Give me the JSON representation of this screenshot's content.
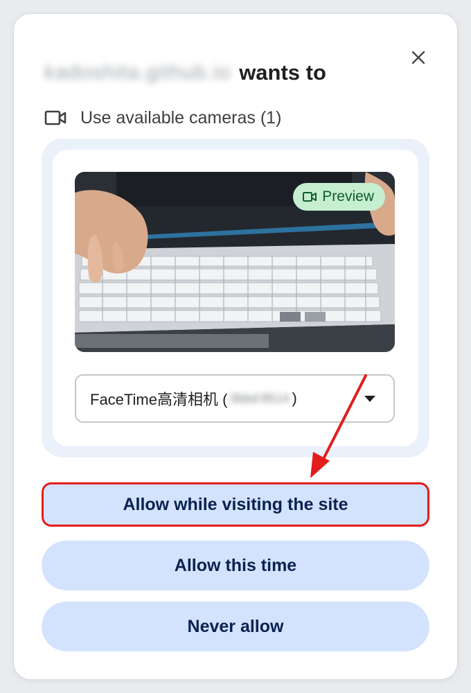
{
  "dialog": {
    "origin_text": "kadoshita.github.io",
    "title_suffix": "wants to",
    "close_icon": "close-icon"
  },
  "permission": {
    "icon": "video-camera-icon",
    "label": "Use available cameras (1)"
  },
  "preview": {
    "badge_icon": "video-camera-icon",
    "badge_label": "Preview"
  },
  "camera_select": {
    "selected_name": "FaceTime高清相机 (",
    "selected_id_blurred": "0bbd:8514",
    "closing_paren": ")"
  },
  "buttons": {
    "allow_site": "Allow while visiting the site",
    "allow_once": "Allow this time",
    "never": "Never allow"
  },
  "colors": {
    "button_bg": "#d3e3fd",
    "button_text": "#0b2150",
    "panel_bg": "#ebf1fa",
    "badge_bg": "#c6eed0",
    "annotation_red": "#e31c1c"
  }
}
